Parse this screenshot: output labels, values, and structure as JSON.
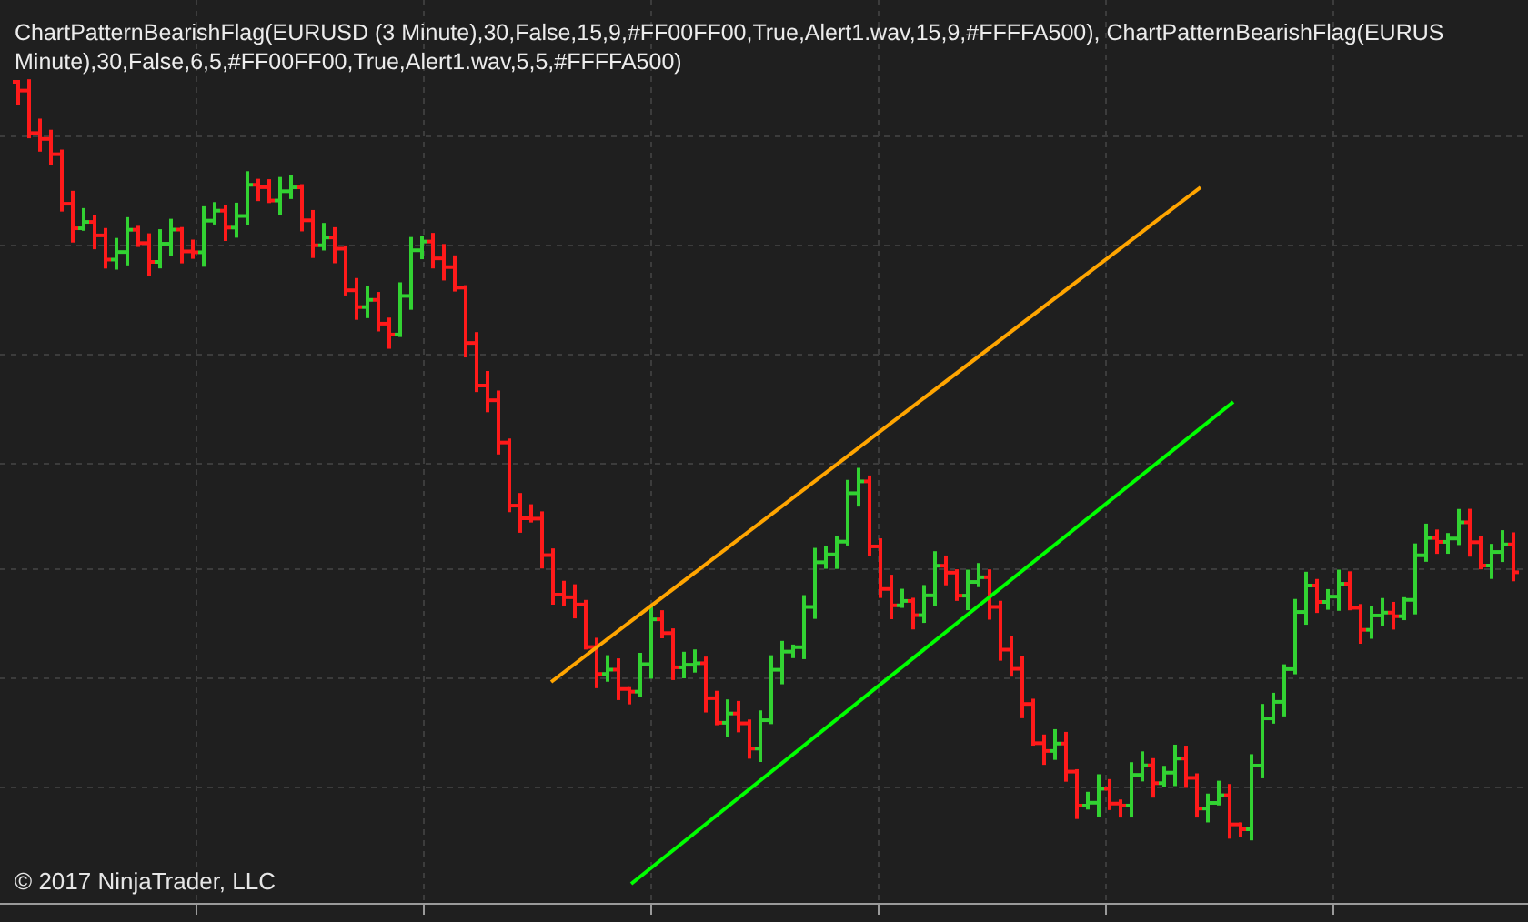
{
  "indicator_label": {
    "lines": [
      "ChartPatternBearishFlag(EURUSD (3 Minute),30,False,15,9,#FF00FF00,True,Alert1.wav,15,9,#FFFFA500), ChartPatternBearishFlag(EURUS",
      "Minute),30,False,6,5,#FF00FF00,True,Alert1.wav,5,5,#FFFFA500)"
    ]
  },
  "copyright": "© 2017 NinjaTrader, LLC"
}
